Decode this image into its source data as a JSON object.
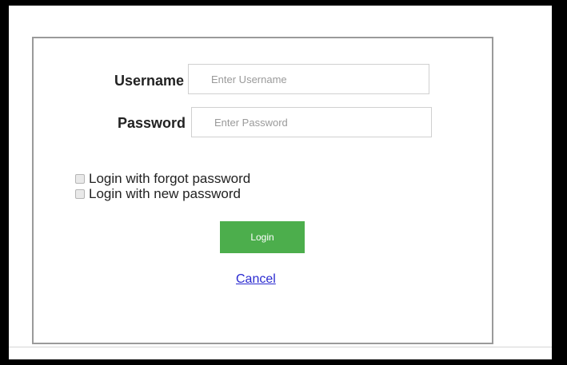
{
  "form": {
    "username_label": "Username",
    "username_placeholder": "Enter Username",
    "password_label": "Password",
    "password_placeholder": "Enter Password",
    "options": [
      {
        "label": "Login with forgot password",
        "checked": false
      },
      {
        "label": "Login with new password",
        "checked": false
      }
    ],
    "login_label": "Login",
    "cancel_label": "Cancel"
  },
  "colors": {
    "login_button": "#4cae4c",
    "link": "#2a2ad0",
    "frame": "#000000"
  }
}
